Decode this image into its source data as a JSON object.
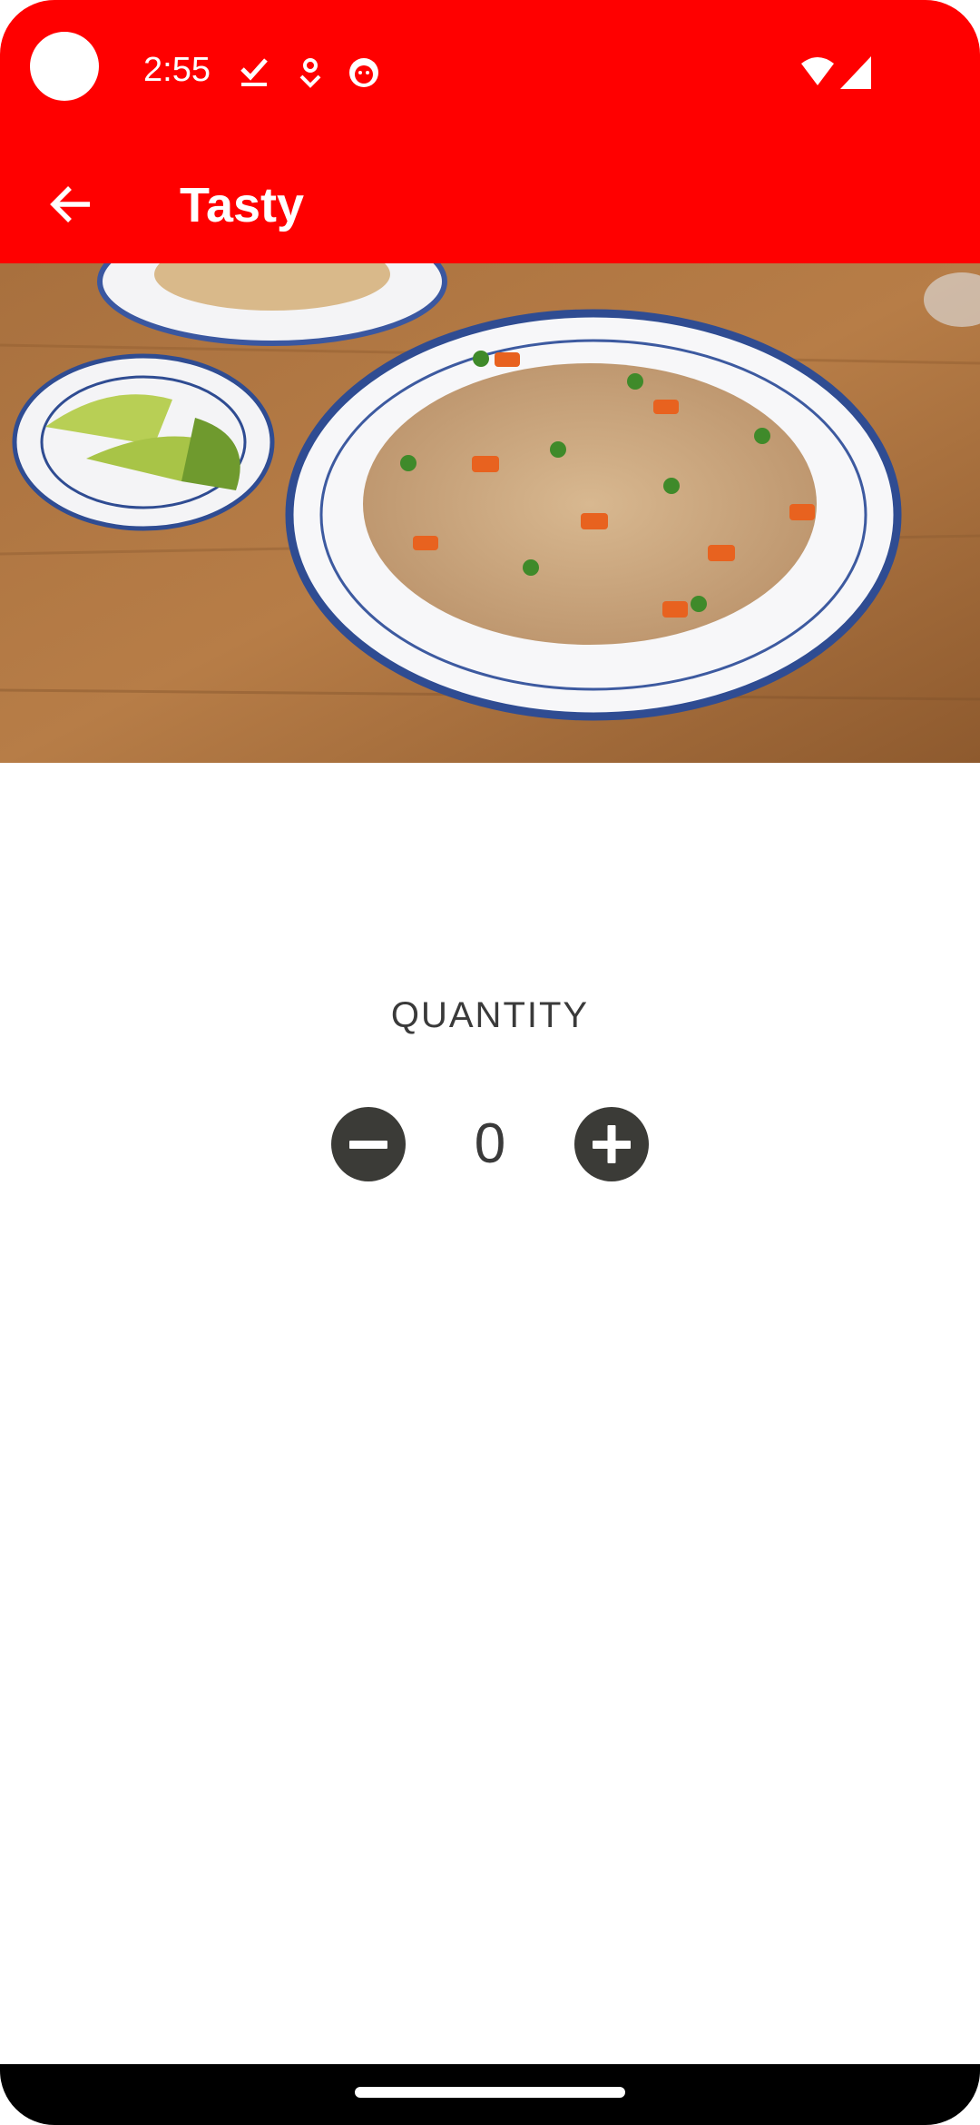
{
  "status_bar": {
    "time": "2:55",
    "icons_left": [
      "check-download-icon",
      "location-pin-icon",
      "face-icon"
    ],
    "icons_right": [
      "wifi-icon",
      "cellular-signal-icon"
    ]
  },
  "app_bar": {
    "title": "Tasty",
    "back_icon": "arrow-back-icon",
    "background_color": "#ff0000"
  },
  "hero_image": {
    "subject": "fried-rice-dish-photo"
  },
  "quantity": {
    "label": "QUANTITY",
    "value": "0",
    "decrement_icon": "minus-circle-icon",
    "increment_icon": "plus-circle-icon",
    "button_color": "#3b3b37"
  },
  "navigation_bar": {
    "home_indicator": "gesture-home-handle"
  }
}
